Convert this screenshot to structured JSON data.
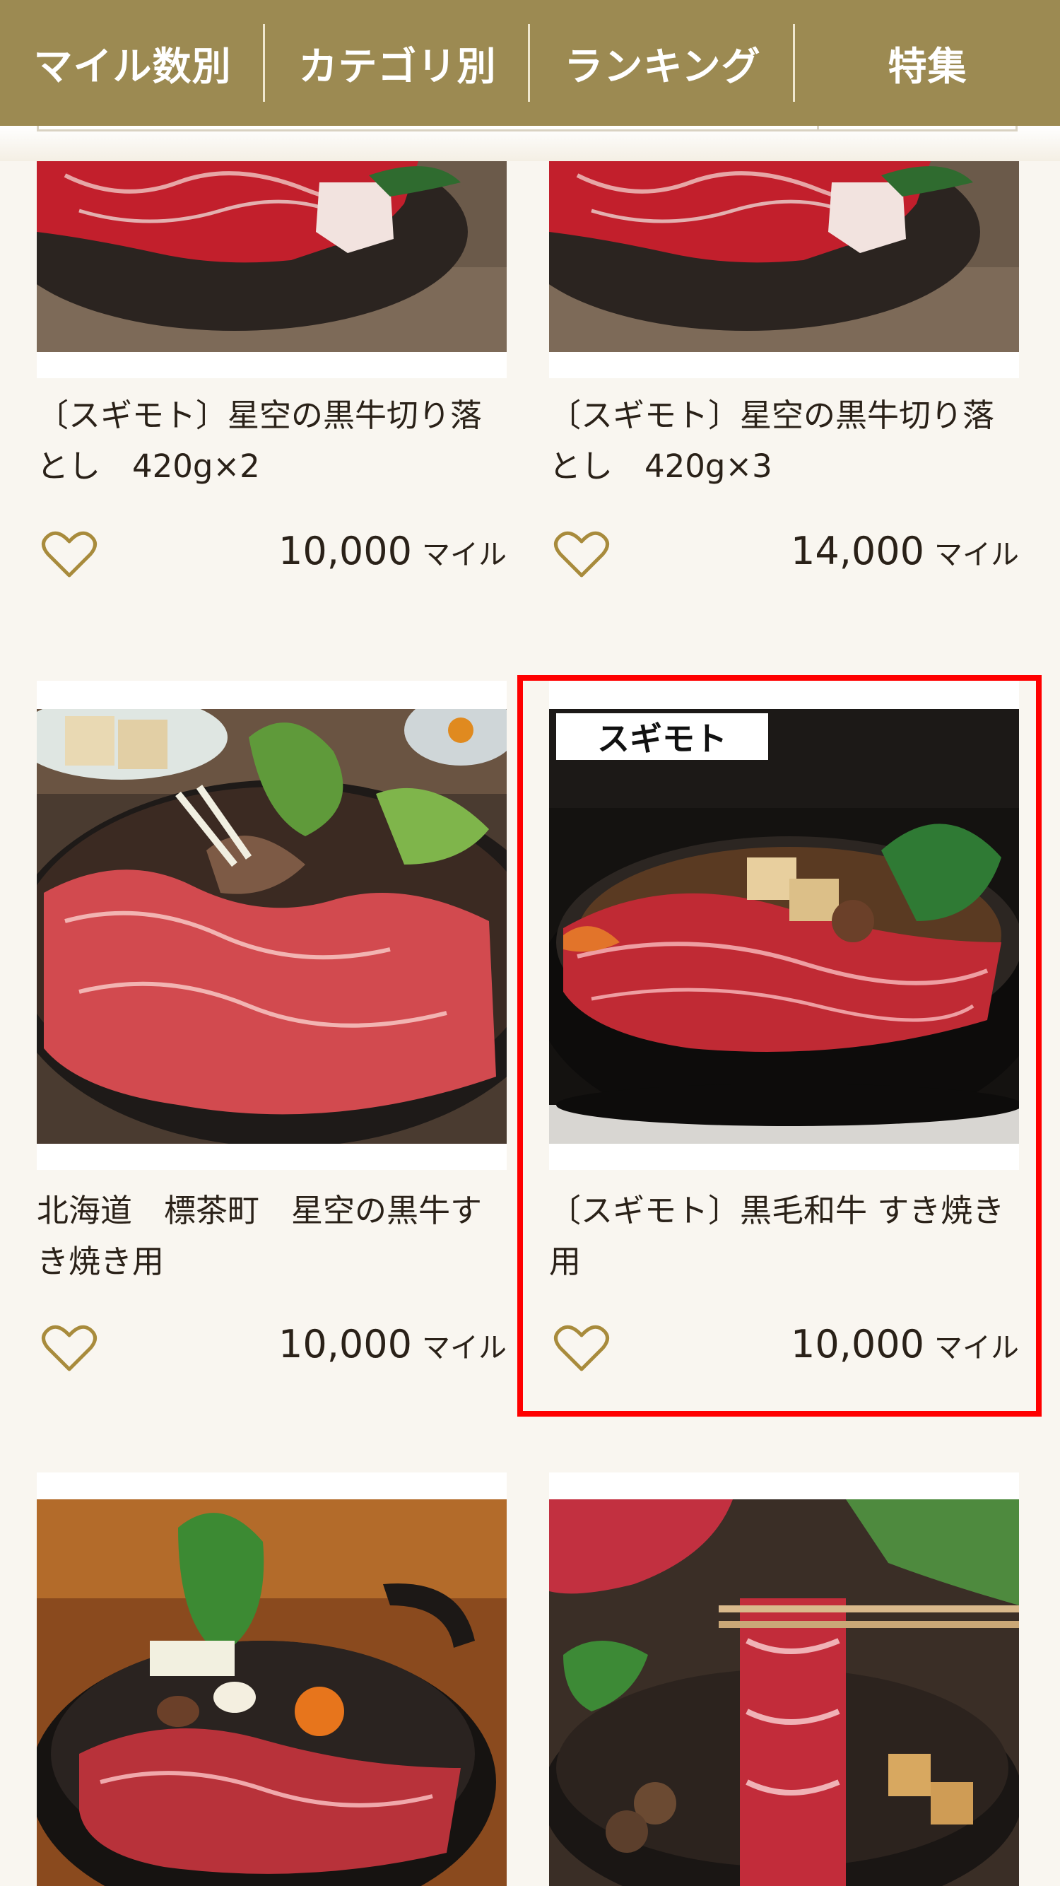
{
  "nav": {
    "items": [
      {
        "label": "マイル数別"
      },
      {
        "label": "カテゴリ別"
      },
      {
        "label": "ランキング"
      },
      {
        "label": "特集"
      }
    ]
  },
  "products": [
    {
      "title": "〔スギモト〕星空の黒牛切り落とし　420g×2",
      "price": "10,000",
      "unit": "マイル"
    },
    {
      "title": "〔スギモト〕星空の黒牛切り落とし　420g×3",
      "price": "14,000",
      "unit": "マイル"
    },
    {
      "title": "北海道　標茶町　星空の黒牛すき焼き用",
      "price": "10,000",
      "unit": "マイル"
    },
    {
      "title": "〔スギモト〕黒毛和牛 すき焼き用",
      "price": "10,000",
      "unit": "マイル",
      "logo": "スギモト"
    },
    {},
    {}
  ],
  "colors": {
    "nav_bg": "#9c8a52",
    "page_bg": "#f9f6f0",
    "heart": "#a88b3c",
    "highlight": "#ff0000"
  },
  "icons": {
    "favorite": "heart-outline-icon"
  }
}
